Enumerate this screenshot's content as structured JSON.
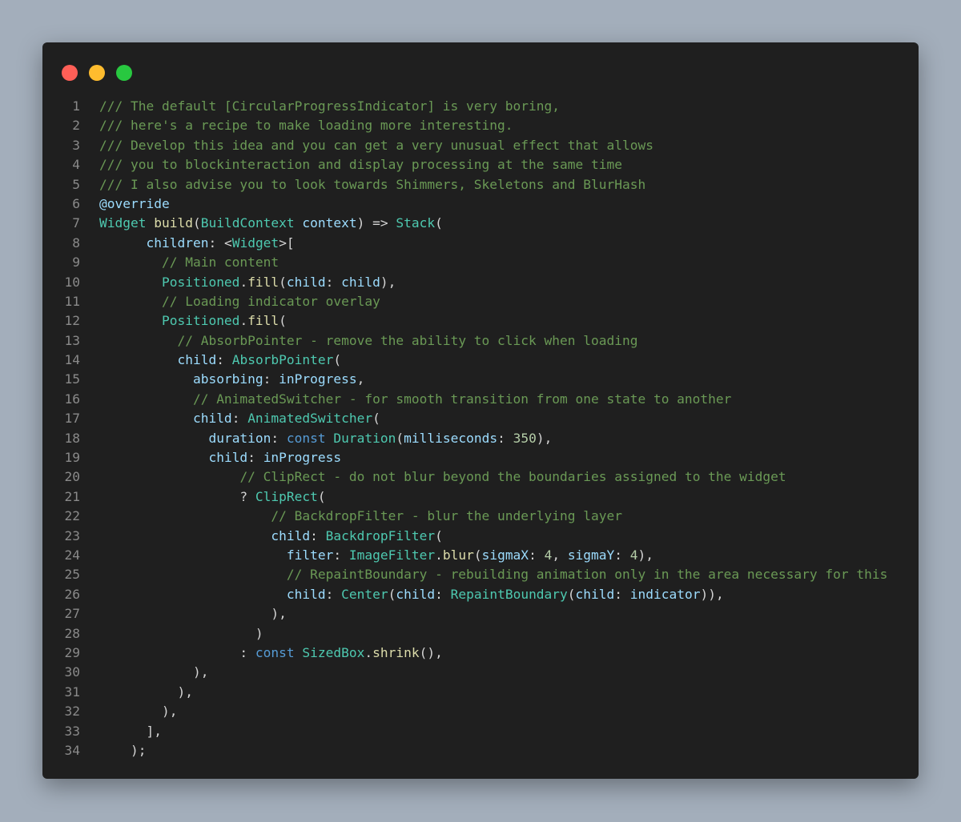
{
  "window": {
    "controls": {
      "close_color": "#ff5f57",
      "minimize_color": "#febc2e",
      "zoom_color": "#28c840"
    }
  },
  "theme": {
    "background": "#1f1f1f",
    "line_number": "#8a8a8a",
    "comment": "#6a9955",
    "keyword": "#569cd6",
    "type": "#4ec9b0",
    "function": "#dcdcaa",
    "property": "#9cdcfe",
    "number": "#b5cea8",
    "plain": "#d4d4d4"
  },
  "code_lines": [
    {
      "n": "1",
      "tokens": [
        {
          "t": "/// The default [CircularProgressIndicator] is very boring,",
          "k": "cm"
        }
      ]
    },
    {
      "n": "2",
      "tokens": [
        {
          "t": "/// here's a recipe to make loading more interesting.",
          "k": "cm"
        }
      ]
    },
    {
      "n": "3",
      "tokens": [
        {
          "t": "/// Develop this idea and you can get a very unusual effect that allows",
          "k": "cm"
        }
      ]
    },
    {
      "n": "4",
      "tokens": [
        {
          "t": "/// you to blockinteraction and display processing at the same time",
          "k": "cm"
        }
      ]
    },
    {
      "n": "5",
      "tokens": [
        {
          "t": "/// I also advise you to look towards Shimmers, Skeletons and BlurHash",
          "k": "cm"
        }
      ]
    },
    {
      "n": "6",
      "tokens": [
        {
          "t": "@override",
          "k": "pr"
        }
      ]
    },
    {
      "n": "7",
      "tokens": [
        {
          "t": "Widget",
          "k": "ty"
        },
        {
          "t": " ",
          "k": "pl"
        },
        {
          "t": "build",
          "k": "fn"
        },
        {
          "t": "(",
          "k": "pl"
        },
        {
          "t": "BuildContext",
          "k": "ty"
        },
        {
          "t": " ",
          "k": "pl"
        },
        {
          "t": "context",
          "k": "pr"
        },
        {
          "t": ") => ",
          "k": "pl"
        },
        {
          "t": "Stack",
          "k": "ty"
        },
        {
          "t": "(",
          "k": "pl"
        }
      ]
    },
    {
      "n": "8",
      "tokens": [
        {
          "t": "      ",
          "k": "pl"
        },
        {
          "t": "children",
          "k": "pr"
        },
        {
          "t": ": <",
          "k": "pl"
        },
        {
          "t": "Widget",
          "k": "ty"
        },
        {
          "t": ">[",
          "k": "pl"
        }
      ]
    },
    {
      "n": "9",
      "tokens": [
        {
          "t": "        ",
          "k": "pl"
        },
        {
          "t": "// Main content",
          "k": "cm"
        }
      ]
    },
    {
      "n": "10",
      "tokens": [
        {
          "t": "        ",
          "k": "pl"
        },
        {
          "t": "Positioned",
          "k": "ty"
        },
        {
          "t": ".",
          "k": "pl"
        },
        {
          "t": "fill",
          "k": "fn"
        },
        {
          "t": "(",
          "k": "pl"
        },
        {
          "t": "child",
          "k": "pr"
        },
        {
          "t": ": ",
          "k": "pl"
        },
        {
          "t": "child",
          "k": "pr"
        },
        {
          "t": "),",
          "k": "pl"
        }
      ]
    },
    {
      "n": "11",
      "tokens": [
        {
          "t": "        ",
          "k": "pl"
        },
        {
          "t": "// Loading indicator overlay",
          "k": "cm"
        }
      ]
    },
    {
      "n": "12",
      "tokens": [
        {
          "t": "        ",
          "k": "pl"
        },
        {
          "t": "Positioned",
          "k": "ty"
        },
        {
          "t": ".",
          "k": "pl"
        },
        {
          "t": "fill",
          "k": "fn"
        },
        {
          "t": "(",
          "k": "pl"
        }
      ]
    },
    {
      "n": "13",
      "tokens": [
        {
          "t": "          ",
          "k": "pl"
        },
        {
          "t": "// AbsorbPointer - remove the ability to click when loading",
          "k": "cm"
        }
      ]
    },
    {
      "n": "14",
      "tokens": [
        {
          "t": "          ",
          "k": "pl"
        },
        {
          "t": "child",
          "k": "pr"
        },
        {
          "t": ": ",
          "k": "pl"
        },
        {
          "t": "AbsorbPointer",
          "k": "ty"
        },
        {
          "t": "(",
          "k": "pl"
        }
      ]
    },
    {
      "n": "15",
      "tokens": [
        {
          "t": "            ",
          "k": "pl"
        },
        {
          "t": "absorbing",
          "k": "pr"
        },
        {
          "t": ": ",
          "k": "pl"
        },
        {
          "t": "inProgress",
          "k": "pr"
        },
        {
          "t": ",",
          "k": "pl"
        }
      ]
    },
    {
      "n": "16",
      "tokens": [
        {
          "t": "            ",
          "k": "pl"
        },
        {
          "t": "// AnimatedSwitcher - for smooth transition from one state to another",
          "k": "cm"
        }
      ]
    },
    {
      "n": "17",
      "tokens": [
        {
          "t": "            ",
          "k": "pl"
        },
        {
          "t": "child",
          "k": "pr"
        },
        {
          "t": ": ",
          "k": "pl"
        },
        {
          "t": "AnimatedSwitcher",
          "k": "ty"
        },
        {
          "t": "(",
          "k": "pl"
        }
      ]
    },
    {
      "n": "18",
      "tokens": [
        {
          "t": "              ",
          "k": "pl"
        },
        {
          "t": "duration",
          "k": "pr"
        },
        {
          "t": ": ",
          "k": "pl"
        },
        {
          "t": "const",
          "k": "kw"
        },
        {
          "t": " ",
          "k": "pl"
        },
        {
          "t": "Duration",
          "k": "ty"
        },
        {
          "t": "(",
          "k": "pl"
        },
        {
          "t": "milliseconds",
          "k": "pr"
        },
        {
          "t": ": ",
          "k": "pl"
        },
        {
          "t": "350",
          "k": "nu"
        },
        {
          "t": "),",
          "k": "pl"
        }
      ]
    },
    {
      "n": "19",
      "tokens": [
        {
          "t": "              ",
          "k": "pl"
        },
        {
          "t": "child",
          "k": "pr"
        },
        {
          "t": ": ",
          "k": "pl"
        },
        {
          "t": "inProgress",
          "k": "pr"
        }
      ]
    },
    {
      "n": "20",
      "tokens": [
        {
          "t": "                  ",
          "k": "pl"
        },
        {
          "t": "// ClipRect - do not blur beyond the boundaries assigned to the widget",
          "k": "cm"
        }
      ]
    },
    {
      "n": "21",
      "tokens": [
        {
          "t": "                  ? ",
          "k": "pl"
        },
        {
          "t": "ClipRect",
          "k": "ty"
        },
        {
          "t": "(",
          "k": "pl"
        }
      ]
    },
    {
      "n": "22",
      "tokens": [
        {
          "t": "                      ",
          "k": "pl"
        },
        {
          "t": "// BackdropFilter - blur the underlying layer",
          "k": "cm"
        }
      ]
    },
    {
      "n": "23",
      "tokens": [
        {
          "t": "                      ",
          "k": "pl"
        },
        {
          "t": "child",
          "k": "pr"
        },
        {
          "t": ": ",
          "k": "pl"
        },
        {
          "t": "BackdropFilter",
          "k": "ty"
        },
        {
          "t": "(",
          "k": "pl"
        }
      ]
    },
    {
      "n": "24",
      "tokens": [
        {
          "t": "                        ",
          "k": "pl"
        },
        {
          "t": "filter",
          "k": "pr"
        },
        {
          "t": ": ",
          "k": "pl"
        },
        {
          "t": "ImageFilter",
          "k": "ty"
        },
        {
          "t": ".",
          "k": "pl"
        },
        {
          "t": "blur",
          "k": "fn"
        },
        {
          "t": "(",
          "k": "pl"
        },
        {
          "t": "sigmaX",
          "k": "pr"
        },
        {
          "t": ": ",
          "k": "pl"
        },
        {
          "t": "4",
          "k": "nu"
        },
        {
          "t": ", ",
          "k": "pl"
        },
        {
          "t": "sigmaY",
          "k": "pr"
        },
        {
          "t": ": ",
          "k": "pl"
        },
        {
          "t": "4",
          "k": "nu"
        },
        {
          "t": "),",
          "k": "pl"
        }
      ]
    },
    {
      "n": "25",
      "tokens": [
        {
          "t": "                        ",
          "k": "pl"
        },
        {
          "t": "// RepaintBoundary - rebuilding animation only in the area necessary for this",
          "k": "cm"
        }
      ]
    },
    {
      "n": "26",
      "tokens": [
        {
          "t": "                        ",
          "k": "pl"
        },
        {
          "t": "child",
          "k": "pr"
        },
        {
          "t": ": ",
          "k": "pl"
        },
        {
          "t": "Center",
          "k": "ty"
        },
        {
          "t": "(",
          "k": "pl"
        },
        {
          "t": "child",
          "k": "pr"
        },
        {
          "t": ": ",
          "k": "pl"
        },
        {
          "t": "RepaintBoundary",
          "k": "ty"
        },
        {
          "t": "(",
          "k": "pl"
        },
        {
          "t": "child",
          "k": "pr"
        },
        {
          "t": ": ",
          "k": "pl"
        },
        {
          "t": "indicator",
          "k": "pr"
        },
        {
          "t": ")),",
          "k": "pl"
        }
      ]
    },
    {
      "n": "27",
      "tokens": [
        {
          "t": "                      ),",
          "k": "pl"
        }
      ]
    },
    {
      "n": "28",
      "tokens": [
        {
          "t": "                    )",
          "k": "pl"
        }
      ]
    },
    {
      "n": "29",
      "tokens": [
        {
          "t": "                  : ",
          "k": "pl"
        },
        {
          "t": "const",
          "k": "kw"
        },
        {
          "t": " ",
          "k": "pl"
        },
        {
          "t": "SizedBox",
          "k": "ty"
        },
        {
          "t": ".",
          "k": "pl"
        },
        {
          "t": "shrink",
          "k": "fn"
        },
        {
          "t": "(),",
          "k": "pl"
        }
      ]
    },
    {
      "n": "30",
      "tokens": [
        {
          "t": "            ),",
          "k": "pl"
        }
      ]
    },
    {
      "n": "31",
      "tokens": [
        {
          "t": "          ),",
          "k": "pl"
        }
      ]
    },
    {
      "n": "32",
      "tokens": [
        {
          "t": "        ),",
          "k": "pl"
        }
      ]
    },
    {
      "n": "33",
      "tokens": [
        {
          "t": "      ],",
          "k": "pl"
        }
      ]
    },
    {
      "n": "34",
      "tokens": [
        {
          "t": "    );",
          "k": "pl"
        }
      ]
    }
  ]
}
